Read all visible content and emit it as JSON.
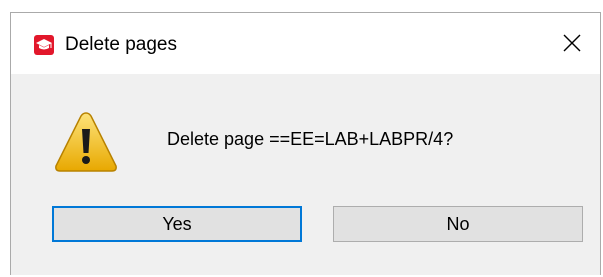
{
  "window": {
    "title": "Delete pages",
    "app_icon": "graduation-cap-icon",
    "close_icon": "close-icon"
  },
  "dialog": {
    "icon": "warning-icon",
    "message": "Delete page ==EE=LAB+LABPR/4?"
  },
  "buttons": {
    "yes_label": "Yes",
    "no_label": "No"
  },
  "colors": {
    "app_icon_bg": "#e2172b",
    "focus_border": "#0078d7",
    "button_bg": "#e1e1e1",
    "dialog_bg": "#f0f0f0",
    "warning_yellow": "#f5c518"
  }
}
